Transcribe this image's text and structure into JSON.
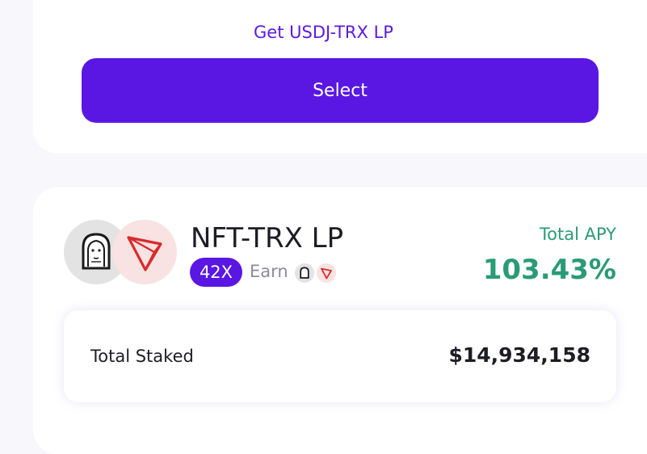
{
  "top_card": {
    "get_lp_link": "Get USDJ-TRX LP",
    "select_button": "Select"
  },
  "pool": {
    "token_a_icon": "nft-token-icon",
    "token_b_icon": "trx-token-icon",
    "title": "NFT-TRX LP",
    "multiplier": "42X",
    "earn_label": "Earn",
    "apy_label": "Total APY",
    "apy_value": "103.43%",
    "staked_label": "Total Staked",
    "staked_value": "$14,934,158"
  },
  "colors": {
    "accent_purple": "#5a17e4",
    "apy_green": "#2a9b76",
    "trx_red": "#d92b2b"
  }
}
